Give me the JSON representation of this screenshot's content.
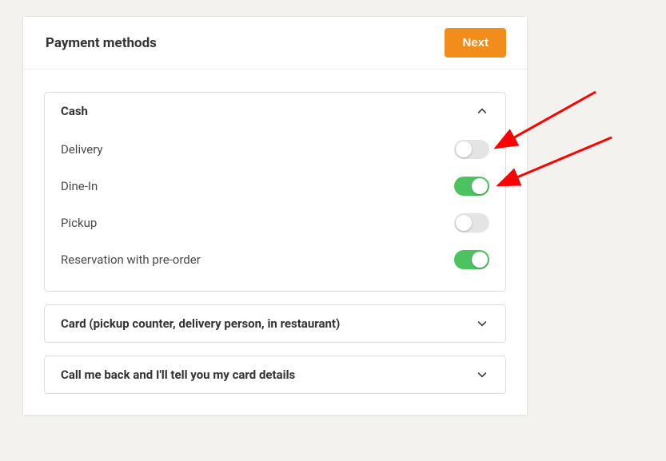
{
  "header": {
    "title": "Payment methods",
    "nextLabel": "Next"
  },
  "panels": {
    "cash": {
      "title": "Cash",
      "rows": [
        {
          "label": "Delivery",
          "on": false
        },
        {
          "label": "Dine-In",
          "on": true
        },
        {
          "label": "Pickup",
          "on": false
        },
        {
          "label": "Reservation with pre-order",
          "on": true
        }
      ]
    },
    "card": {
      "title": "Card (pickup counter, delivery person, in restaurant)"
    },
    "callback": {
      "title": "Call me back and I'll tell you my card details"
    }
  },
  "colors": {
    "accent": "#f28c1a",
    "toggleOn": "#4cc35f",
    "toggleOff": "#e4e4e4",
    "arrow": "#ff0000"
  }
}
